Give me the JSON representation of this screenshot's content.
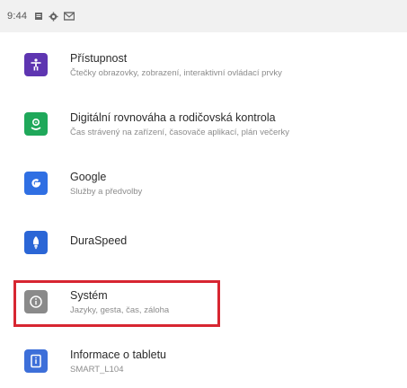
{
  "status_bar": {
    "time": "9:44",
    "icons": [
      "notification-box-icon",
      "settings-gear-icon",
      "mail-icon"
    ]
  },
  "settings": [
    {
      "id": "accessibility",
      "title": "Přístupnost",
      "subtitle": "Čtečky obrazovky, zobrazení, interaktivní ovládací prvky",
      "icon": "accessibility-icon",
      "color": "#5e35b1"
    },
    {
      "id": "digital-wellbeing",
      "title": "Digitální rovnováha a rodičovská kontrola",
      "subtitle": "Čas strávený na zařízení, časovače aplikací, plán večerky",
      "icon": "wellbeing-icon",
      "color": "#1fa85a"
    },
    {
      "id": "google",
      "title": "Google",
      "subtitle": "Služby a předvolby",
      "icon": "google-icon",
      "color": "#2f6fe3"
    },
    {
      "id": "durasped",
      "title": "DuraSpeed",
      "subtitle": "",
      "icon": "rocket-icon",
      "color": "#2b66d6"
    },
    {
      "id": "system",
      "title": "Systém",
      "subtitle": "Jazyky, gesta, čas, záloha",
      "icon": "info-icon",
      "color": "#8a8a8a"
    },
    {
      "id": "about-tablet",
      "title": "Informace o tabletu",
      "subtitle": "SMART_L104",
      "icon": "tablet-icon",
      "color": "#3d6fd9"
    }
  ],
  "highlight": {
    "target": "system",
    "color": "#d72631"
  }
}
